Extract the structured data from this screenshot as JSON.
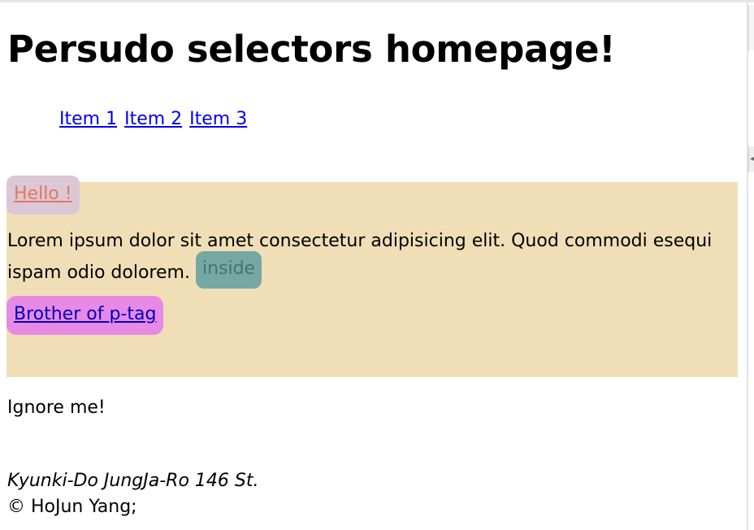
{
  "page": {
    "heading": "Persudo selectors homepage!"
  },
  "nav": {
    "items": [
      {
        "label": "Item 1"
      },
      {
        "label": "Item 2"
      },
      {
        "label": "Item 3"
      }
    ]
  },
  "section": {
    "hello_link": "Hello !",
    "paragraph_text": "Lorem ipsum dolor sit amet consectetur adipisicing elit. Quod commodi esequi ispam odio dolorem.",
    "inside_label": "inside",
    "brother_link": "Brother of p-tag"
  },
  "ignore_text": "Ignore me!",
  "footer": {
    "address": "Kyunki-Do JungJa-Ro 146 St.",
    "copyright": "© HoJun Yang;"
  },
  "colors": {
    "section_background": "#f0dfb6",
    "hello_background": "#dcc7d6",
    "hello_text": "#e2785f",
    "inside_background": "#76a8a3",
    "brother_background": "#e68ae6",
    "link": "#0000ee"
  }
}
